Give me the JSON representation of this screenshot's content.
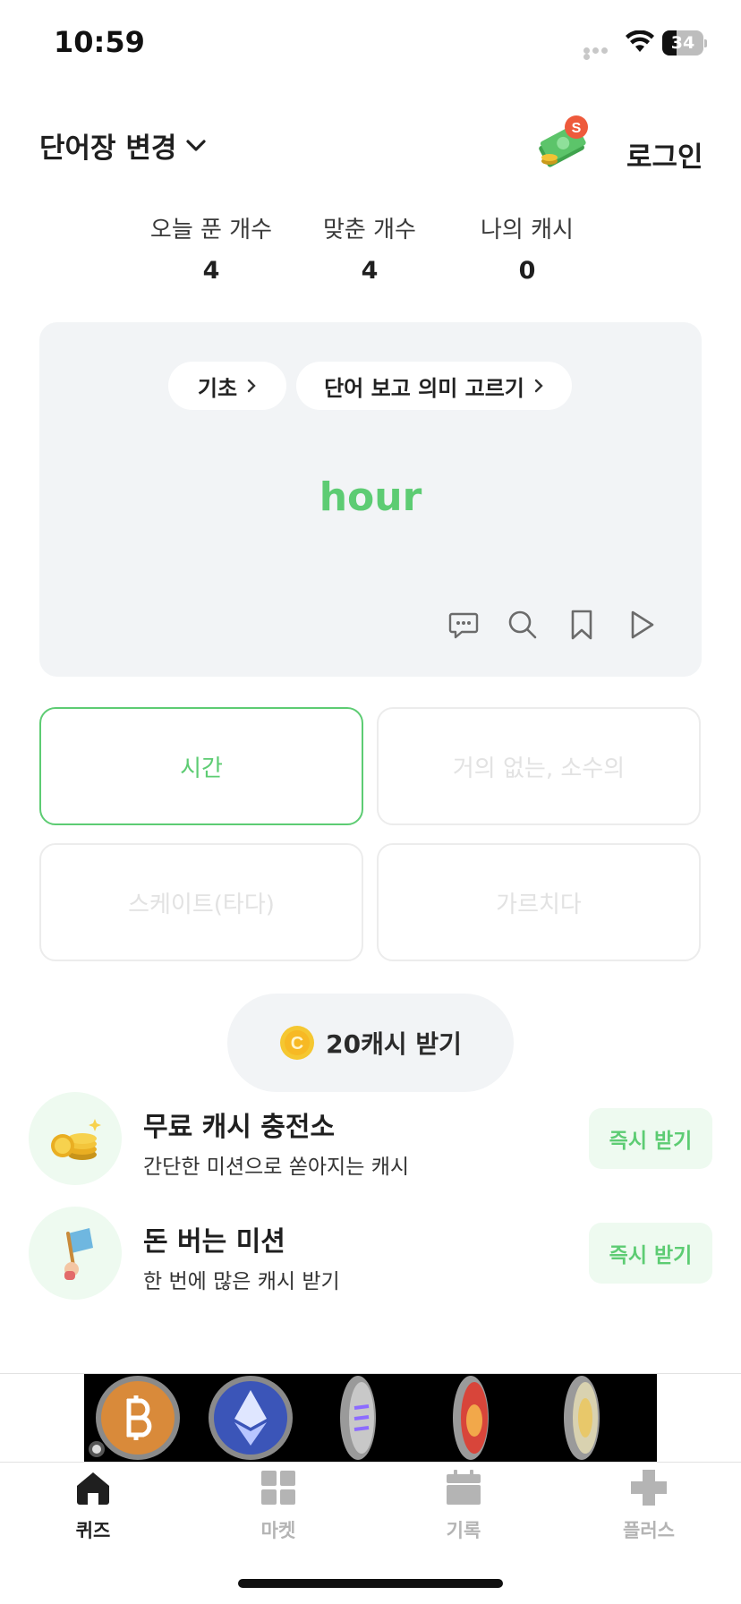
{
  "status_bar": {
    "time": "10:59",
    "battery": "34",
    "battery_level": 0.34
  },
  "header": {
    "wordbook_change": "단어장 변경",
    "login": "로그인",
    "notification_badge": "S"
  },
  "stats": [
    {
      "label": "오늘 푼 개수",
      "value": "4"
    },
    {
      "label": "맞춘 개수",
      "value": "4"
    },
    {
      "label": "나의 캐시",
      "value": "0"
    }
  ],
  "quiz": {
    "level_chip": "기초",
    "mode_chip": "단어 보고 의미 고르기",
    "word": "hour",
    "icons": [
      "comment-icon",
      "search-icon",
      "bookmark-icon",
      "play-icon"
    ]
  },
  "answers": [
    {
      "text": "시간",
      "selected": true
    },
    {
      "text": "거의 없는, 소수의",
      "selected": false
    },
    {
      "text": "스케이트(타다)",
      "selected": false
    },
    {
      "text": "가르치다",
      "selected": false
    }
  ],
  "reward": {
    "coin_letter": "C",
    "label": "20캐시 받기"
  },
  "promos": [
    {
      "title": "무료 캐시 충전소",
      "desc": "간단한 미션으로 쏟아지는 캐시",
      "button": "즉시 받기",
      "icon": "coins-icon"
    },
    {
      "title": "돈 버는 미션",
      "desc": "한 번에 많은 캐시 받기",
      "button": "즉시 받기",
      "icon": "flag-icon"
    }
  ],
  "tabs": [
    {
      "label": "퀴즈",
      "icon": "home-icon",
      "active": true
    },
    {
      "label": "마켓",
      "icon": "grid-icon",
      "active": false
    },
    {
      "label": "기록",
      "icon": "calendar-icon",
      "active": false
    },
    {
      "label": "플러스",
      "icon": "plus-icon",
      "active": false
    }
  ],
  "colors": {
    "accent": "#5dcc73",
    "card_bg": "#f2f4f6",
    "promo_bg": "#eefaf0"
  }
}
